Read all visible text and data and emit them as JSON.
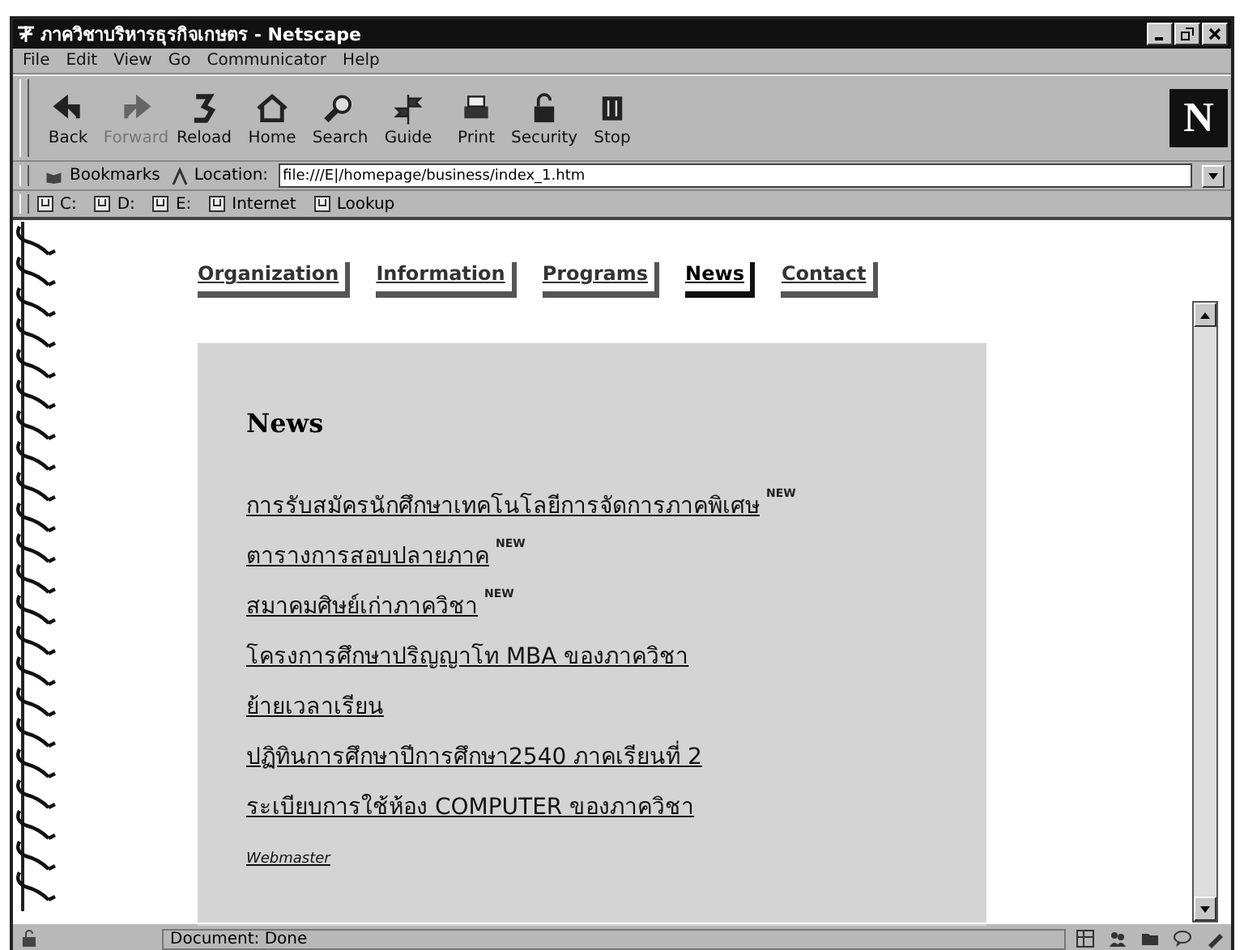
{
  "window": {
    "title": "ภาควิชาบริหารธุรกิจเกษตร - Netscape"
  },
  "menu": [
    "File",
    "Edit",
    "View",
    "Go",
    "Communicator",
    "Help"
  ],
  "toolbar": [
    {
      "label": "Back",
      "disabled": false
    },
    {
      "label": "Forward",
      "disabled": true
    },
    {
      "label": "Reload",
      "disabled": false
    },
    {
      "label": "Home",
      "disabled": false
    },
    {
      "label": "Search",
      "disabled": false
    },
    {
      "label": "Guide",
      "disabled": false
    },
    {
      "label": "Print",
      "disabled": false
    },
    {
      "label": "Security",
      "disabled": false
    },
    {
      "label": "Stop",
      "disabled": false
    }
  ],
  "logo": "N",
  "location_bar": {
    "bookmarks": "Bookmarks",
    "label": "Location:",
    "value": "file:///E|/homepage/business/index_1.htm"
  },
  "personal_bar": [
    "C:",
    "D:",
    "E:",
    "Internet",
    "Lookup"
  ],
  "nav": [
    {
      "label": "Organization",
      "selected": false
    },
    {
      "label": "Information",
      "selected": false
    },
    {
      "label": "Programs",
      "selected": false
    },
    {
      "label": "News",
      "selected": true
    },
    {
      "label": "Contact",
      "selected": false
    }
  ],
  "news": {
    "heading": "News",
    "items": [
      {
        "text": "การรับสมัครนักศึกษาเทคโนโลยีการจัดการภาคพิเศษ",
        "badge": "NEW"
      },
      {
        "text": "ตารางการสอบปลายภาค",
        "badge": "NEW"
      },
      {
        "text": "สมาคมศิษย์เก่าภาควิชา",
        "badge": "NEW"
      },
      {
        "text": "โครงการศึกษาปริญญาโท MBA ของภาควิชา"
      },
      {
        "text": "ย้ายเวลาเรียน"
      },
      {
        "text": "ปฏิทินการศึกษาปีการศึกษา2540 ภาคเรียนที่ 2"
      },
      {
        "text": "ระเบียบการใช้ห้อง COMPUTER ของภาควิชา"
      }
    ],
    "footer_link": "Webmaster"
  },
  "status_bar": {
    "text": "Document: Done"
  }
}
